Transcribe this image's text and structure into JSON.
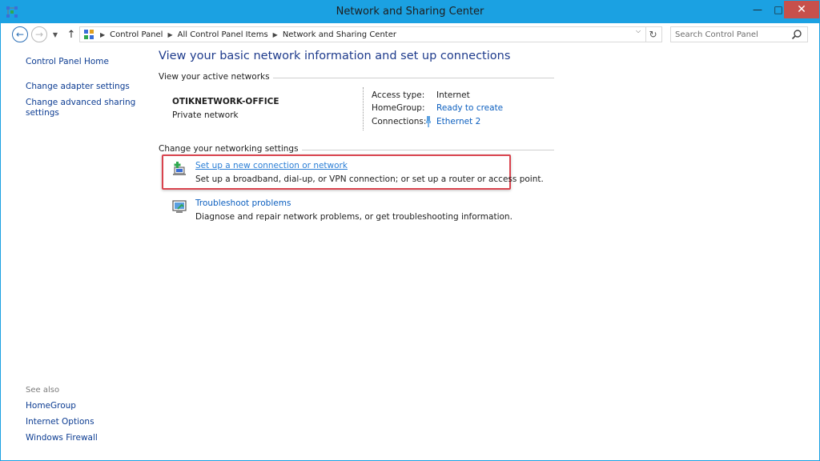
{
  "window": {
    "title": "Network and Sharing Center",
    "accent_color": "#1ba1e2",
    "close_color": "#c7504b"
  },
  "title_buttons": {
    "minimize_glyph": "—",
    "maximize_glyph": "□",
    "close_glyph": "✕"
  },
  "nav": {
    "back_glyph": "←",
    "forward_glyph": "→",
    "recent_glyph": "▼",
    "up_glyph": "↑",
    "refresh_glyph": "↻"
  },
  "address": {
    "crumbs": [
      "Control Panel",
      "All Control Panel Items",
      "Network and Sharing Center"
    ],
    "separator_glyph": "▶",
    "dropdown_glyph": "⌵"
  },
  "search": {
    "placeholder": "Search Control Panel"
  },
  "sidebar": {
    "home": "Control Panel Home",
    "links": [
      "Change adapter settings",
      "Change advanced sharing settings"
    ],
    "see_also_label": "See also",
    "see_also": [
      "HomeGroup",
      "Internet Options",
      "Windows Firewall"
    ]
  },
  "main": {
    "page_title": "View your basic network information and set up connections",
    "active_networks_header": "View your active networks",
    "network": {
      "name": "OTIKNETWORK-OFFICE",
      "type": "Private network",
      "properties": [
        {
          "label": "Access type:",
          "value": "Internet",
          "is_link": false
        },
        {
          "label": "HomeGroup:",
          "value": "Ready to create",
          "is_link": true
        },
        {
          "label": "Connections:",
          "value": "Ethernet 2",
          "is_link": true
        }
      ]
    },
    "settings_header": "Change your networking settings",
    "tasks": [
      {
        "icon": "new-connection-icon",
        "link": "Set up a new connection or network",
        "description": "Set up a broadband, dial-up, or VPN connection; or set up a router or access point.",
        "highlighted": true
      },
      {
        "icon": "troubleshoot-icon",
        "link": "Troubleshoot problems",
        "description": "Diagnose and repair network problems, or get troubleshooting information.",
        "highlighted": false
      }
    ],
    "highlight_color": "#d9434e",
    "link_color": "#0c5fbf"
  }
}
